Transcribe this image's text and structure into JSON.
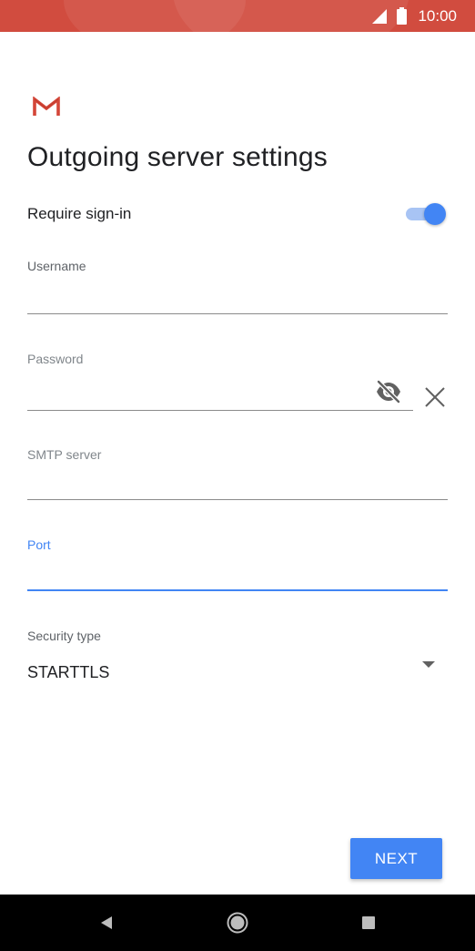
{
  "status_bar": {
    "time": "10:00",
    "icons": [
      "signal-icon",
      "battery-icon"
    ],
    "background": "#d14c3f"
  },
  "app": {
    "logo_icon": "gmail-logo-icon",
    "title": "Outgoing server settings"
  },
  "require_sign_in": {
    "label": "Require sign-in",
    "enabled": true
  },
  "fields": {
    "username": {
      "label": "Username",
      "value": ""
    },
    "password": {
      "label": "Password",
      "value": ""
    },
    "smtp_server": {
      "label": "SMTP server",
      "value": ""
    },
    "port": {
      "label": "Port",
      "value": "",
      "focused": true
    }
  },
  "security_type": {
    "label": "Security type",
    "value": "STARTTLS"
  },
  "buttons": {
    "next": "NEXT"
  },
  "nav_bar": {
    "icons": [
      "back-icon",
      "home-icon",
      "recents-icon"
    ]
  },
  "colors": {
    "accent": "#4285f4",
    "status_bar": "#d14c3f",
    "gmail_red": "#d44638"
  }
}
